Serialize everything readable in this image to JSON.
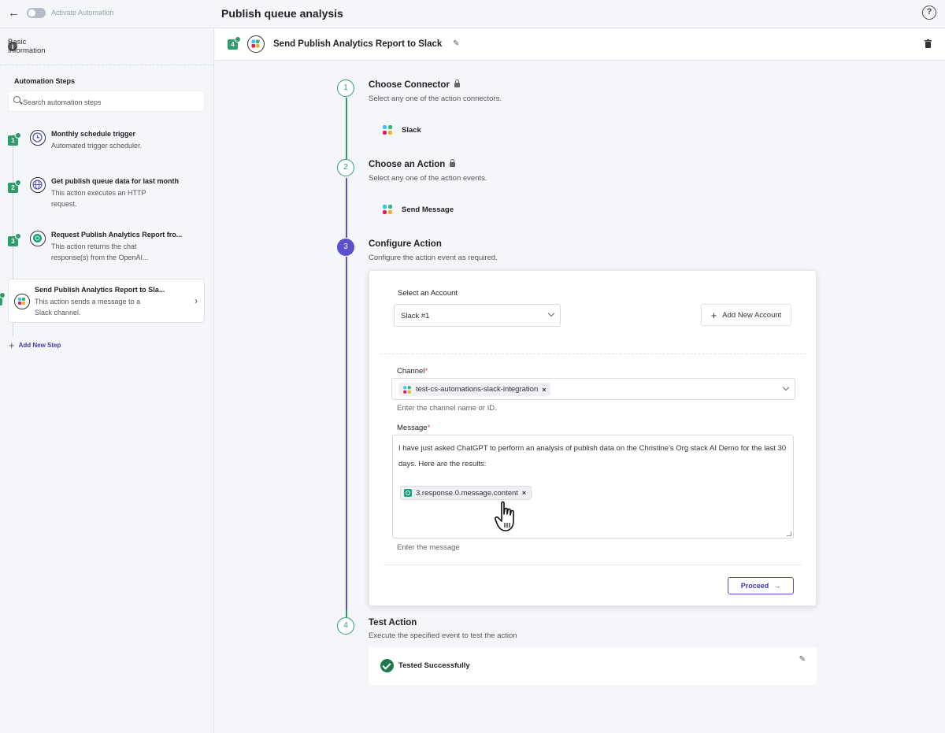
{
  "topbar": {
    "activate_label": "Activate Automation",
    "title": "Publish queue analysis",
    "help": "?"
  },
  "sidebar": {
    "basic_info": "Basic Information",
    "steps_title": "Automation Steps",
    "search_placeholder": "Search automation steps",
    "steps": [
      {
        "num": "1",
        "title": "Monthly schedule trigger",
        "desc": "Automated trigger scheduler.",
        "icon": "clock-icon"
      },
      {
        "num": "2",
        "title": "Get publish queue data for last month",
        "desc": "This action executes an HTTP request.",
        "icon": "globe-icon"
      },
      {
        "num": "3",
        "title": "Request Publish Analytics Report fro...",
        "desc": "This action returns the chat response(s) from the OpenAI...",
        "icon": "openai-icon"
      },
      {
        "num": "4",
        "title": "Send Publish Analytics Report to Sla...",
        "desc": "This action sends a message to a Slack channel.",
        "icon": "slack-icon"
      }
    ],
    "add_step": "Add New Step"
  },
  "main": {
    "step_num": "4",
    "title": "Send Publish Analytics Report to Slack",
    "sections": [
      {
        "num": "1",
        "title": "Choose Connector",
        "sub": "Select any one of the action connectors.",
        "value": "Slack"
      },
      {
        "num": "2",
        "title": "Choose an Action",
        "sub": "Select any one of the action events.",
        "value": "Send Message"
      },
      {
        "num": "3",
        "title": "Configure Action",
        "sub": "Configure the action event as required."
      },
      {
        "num": "4",
        "title": "Test Action",
        "sub": "Execute the specified event to test the action"
      }
    ],
    "config": {
      "account_label": "Select an Account",
      "account_value": "Slack #1",
      "add_account": "Add New Account",
      "channel_label": "Channel",
      "required": "*",
      "channel_chip": "test-cs-automations-slack-integration",
      "channel_hint": "Enter the channel name or ID.",
      "message_label": "Message",
      "message_text": "I have just asked ChatGPT to perform an analysis of publish data on the Christine's Org stack AI Demo for the last 30 days. Here are the results:",
      "message_token": "3.response.0.message.content",
      "message_hint": "Enter the message",
      "proceed": "Proceed"
    },
    "test": {
      "status": "Tested Successfully"
    }
  },
  "colors": {
    "accent": "#5a4fcf",
    "success": "#2e9d6b"
  }
}
